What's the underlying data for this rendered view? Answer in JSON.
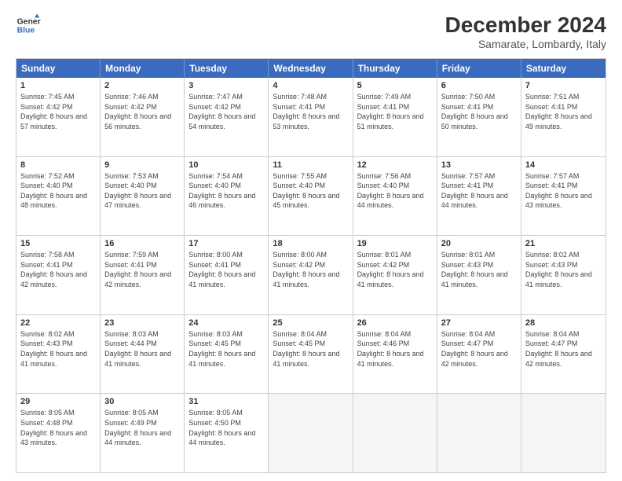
{
  "header": {
    "logo_line1": "General",
    "logo_line2": "Blue",
    "title": "December 2024",
    "subtitle": "Samarate, Lombardy, Italy"
  },
  "calendar": {
    "days_of_week": [
      "Sunday",
      "Monday",
      "Tuesday",
      "Wednesday",
      "Thursday",
      "Friday",
      "Saturday"
    ],
    "weeks": [
      [
        {
          "day": "",
          "empty": true
        },
        {
          "day": "",
          "empty": true
        },
        {
          "day": "",
          "empty": true
        },
        {
          "day": "",
          "empty": true
        },
        {
          "day": "",
          "empty": true
        },
        {
          "day": "",
          "empty": true
        },
        {
          "day": "",
          "empty": true
        }
      ],
      [
        {
          "day": "1",
          "sunrise": "7:45 AM",
          "sunset": "4:42 PM",
          "daylight": "8 hours and 57 minutes."
        },
        {
          "day": "2",
          "sunrise": "7:46 AM",
          "sunset": "4:42 PM",
          "daylight": "8 hours and 56 minutes."
        },
        {
          "day": "3",
          "sunrise": "7:47 AM",
          "sunset": "4:42 PM",
          "daylight": "8 hours and 54 minutes."
        },
        {
          "day": "4",
          "sunrise": "7:48 AM",
          "sunset": "4:41 PM",
          "daylight": "8 hours and 53 minutes."
        },
        {
          "day": "5",
          "sunrise": "7:49 AM",
          "sunset": "4:41 PM",
          "daylight": "8 hours and 51 minutes."
        },
        {
          "day": "6",
          "sunrise": "7:50 AM",
          "sunset": "4:41 PM",
          "daylight": "8 hours and 50 minutes."
        },
        {
          "day": "7",
          "sunrise": "7:51 AM",
          "sunset": "4:41 PM",
          "daylight": "8 hours and 49 minutes."
        }
      ],
      [
        {
          "day": "8",
          "sunrise": "7:52 AM",
          "sunset": "4:40 PM",
          "daylight": "8 hours and 48 minutes."
        },
        {
          "day": "9",
          "sunrise": "7:53 AM",
          "sunset": "4:40 PM",
          "daylight": "8 hours and 47 minutes."
        },
        {
          "day": "10",
          "sunrise": "7:54 AM",
          "sunset": "4:40 PM",
          "daylight": "8 hours and 46 minutes."
        },
        {
          "day": "11",
          "sunrise": "7:55 AM",
          "sunset": "4:40 PM",
          "daylight": "8 hours and 45 minutes."
        },
        {
          "day": "12",
          "sunrise": "7:56 AM",
          "sunset": "4:40 PM",
          "daylight": "8 hours and 44 minutes."
        },
        {
          "day": "13",
          "sunrise": "7:57 AM",
          "sunset": "4:41 PM",
          "daylight": "8 hours and 44 minutes."
        },
        {
          "day": "14",
          "sunrise": "7:57 AM",
          "sunset": "4:41 PM",
          "daylight": "8 hours and 43 minutes."
        }
      ],
      [
        {
          "day": "15",
          "sunrise": "7:58 AM",
          "sunset": "4:41 PM",
          "daylight": "8 hours and 42 minutes."
        },
        {
          "day": "16",
          "sunrise": "7:59 AM",
          "sunset": "4:41 PM",
          "daylight": "8 hours and 42 minutes."
        },
        {
          "day": "17",
          "sunrise": "8:00 AM",
          "sunset": "4:41 PM",
          "daylight": "8 hours and 41 minutes."
        },
        {
          "day": "18",
          "sunrise": "8:00 AM",
          "sunset": "4:42 PM",
          "daylight": "8 hours and 41 minutes."
        },
        {
          "day": "19",
          "sunrise": "8:01 AM",
          "sunset": "4:42 PM",
          "daylight": "8 hours and 41 minutes."
        },
        {
          "day": "20",
          "sunrise": "8:01 AM",
          "sunset": "4:43 PM",
          "daylight": "8 hours and 41 minutes."
        },
        {
          "day": "21",
          "sunrise": "8:02 AM",
          "sunset": "4:43 PM",
          "daylight": "8 hours and 41 minutes."
        }
      ],
      [
        {
          "day": "22",
          "sunrise": "8:02 AM",
          "sunset": "4:43 PM",
          "daylight": "8 hours and 41 minutes."
        },
        {
          "day": "23",
          "sunrise": "8:03 AM",
          "sunset": "4:44 PM",
          "daylight": "8 hours and 41 minutes."
        },
        {
          "day": "24",
          "sunrise": "8:03 AM",
          "sunset": "4:45 PM",
          "daylight": "8 hours and 41 minutes."
        },
        {
          "day": "25",
          "sunrise": "8:04 AM",
          "sunset": "4:45 PM",
          "daylight": "8 hours and 41 minutes."
        },
        {
          "day": "26",
          "sunrise": "8:04 AM",
          "sunset": "4:46 PM",
          "daylight": "8 hours and 41 minutes."
        },
        {
          "day": "27",
          "sunrise": "8:04 AM",
          "sunset": "4:47 PM",
          "daylight": "8 hours and 42 minutes."
        },
        {
          "day": "28",
          "sunrise": "8:04 AM",
          "sunset": "4:47 PM",
          "daylight": "8 hours and 42 minutes."
        }
      ],
      [
        {
          "day": "29",
          "sunrise": "8:05 AM",
          "sunset": "4:48 PM",
          "daylight": "8 hours and 43 minutes."
        },
        {
          "day": "30",
          "sunrise": "8:05 AM",
          "sunset": "4:49 PM",
          "daylight": "8 hours and 44 minutes."
        },
        {
          "day": "31",
          "sunrise": "8:05 AM",
          "sunset": "4:50 PM",
          "daylight": "8 hours and 44 minutes."
        },
        {
          "day": "",
          "empty": true
        },
        {
          "day": "",
          "empty": true
        },
        {
          "day": "",
          "empty": true
        },
        {
          "day": "",
          "empty": true
        }
      ]
    ]
  }
}
